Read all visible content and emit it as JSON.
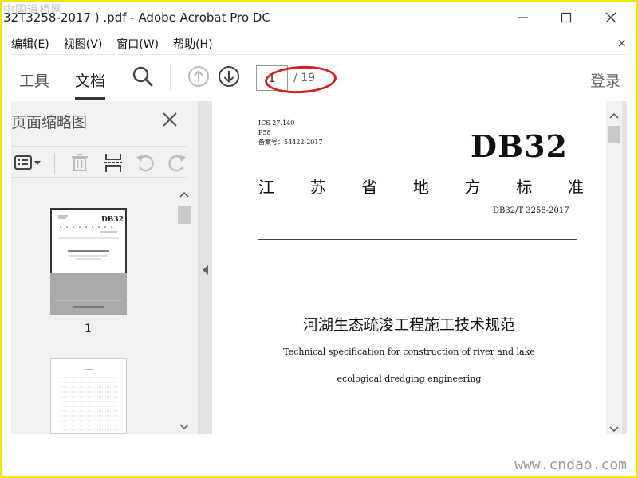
{
  "window": {
    "title": "32T3258-2017 ) .pdf - Adobe Acrobat Pro DC"
  },
  "watermarks": {
    "top": "中国道桥网",
    "bottom": "www.cndao.com"
  },
  "menu": {
    "items": [
      "编辑(E)",
      "视图(V)",
      "窗口(W)",
      "帮助(H)"
    ]
  },
  "toolbar": {
    "tab_tools": "工具",
    "tab_document": "文档",
    "page_value": "1",
    "page_total": "/ 19",
    "login": "登录"
  },
  "panel": {
    "title": "页面缩略图",
    "thumb1_page_number": "1",
    "thumb_mini_db32": "DB32"
  },
  "document": {
    "ics_lines": [
      "ICS  27.140",
      "P58",
      "备案号：54422-2017"
    ],
    "code": "DB32",
    "authority_chars": [
      "江",
      "苏",
      "省",
      "地",
      "方",
      "标",
      "准"
    ],
    "standard_number": "DB32/T 3258-2017",
    "title_cn": "河湖生态疏浚工程施工技术规范",
    "title_en_line1": "Technical specification for construction of river and lake",
    "title_en_line2": "ecological dredging engineering"
  },
  "colors": {
    "frame": "#f2e600",
    "annotation_ring": "#d61f1f"
  }
}
